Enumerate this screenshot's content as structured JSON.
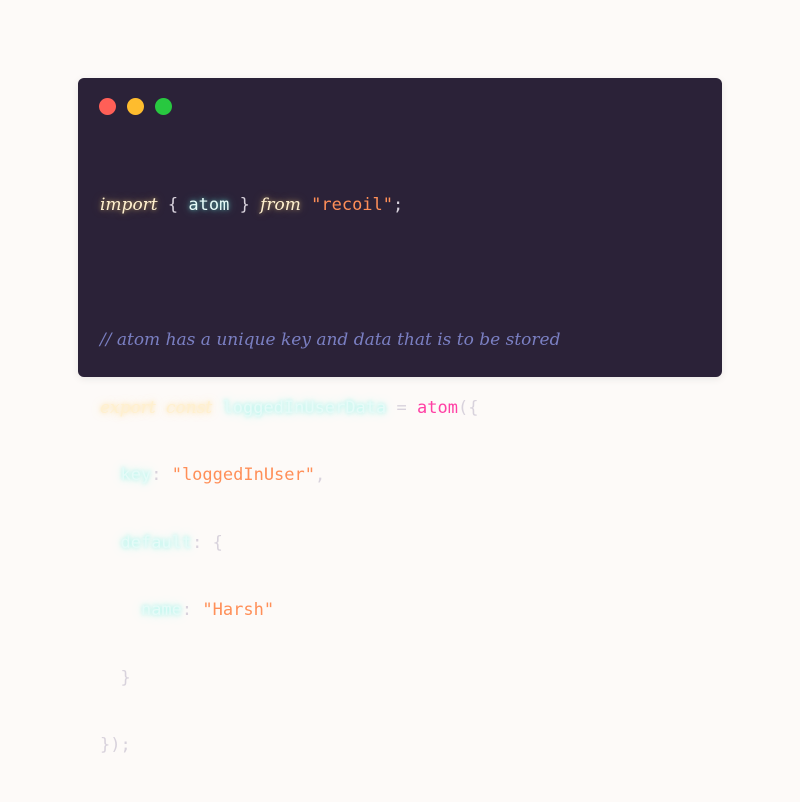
{
  "window": {
    "dots": [
      {
        "name": "close",
        "color": "#ff5f57"
      },
      {
        "name": "minimize",
        "color": "#febc2e"
      },
      {
        "name": "maximize",
        "color": "#28c840"
      }
    ]
  },
  "code": {
    "import_kw": "import",
    "open_brace": "{",
    "atom_ident": "atom",
    "close_brace": "}",
    "from_kw": "from",
    "module_str": "\"recoil\"",
    "semicolon": ";",
    "comment": "// atom has a unique key and data that is to be stored",
    "export_kw": "export",
    "const_kw": "const",
    "var_name": "loggedInUserData",
    "equals": "=",
    "atom_fn": "atom",
    "call_open": "({",
    "key_prop": "key",
    "colon": ":",
    "key_value": "\"loggedInUser\"",
    "comma": ",",
    "default_prop": "default",
    "name_prop": "name",
    "name_value": "\"Harsh\"",
    "call_close": "});"
  }
}
